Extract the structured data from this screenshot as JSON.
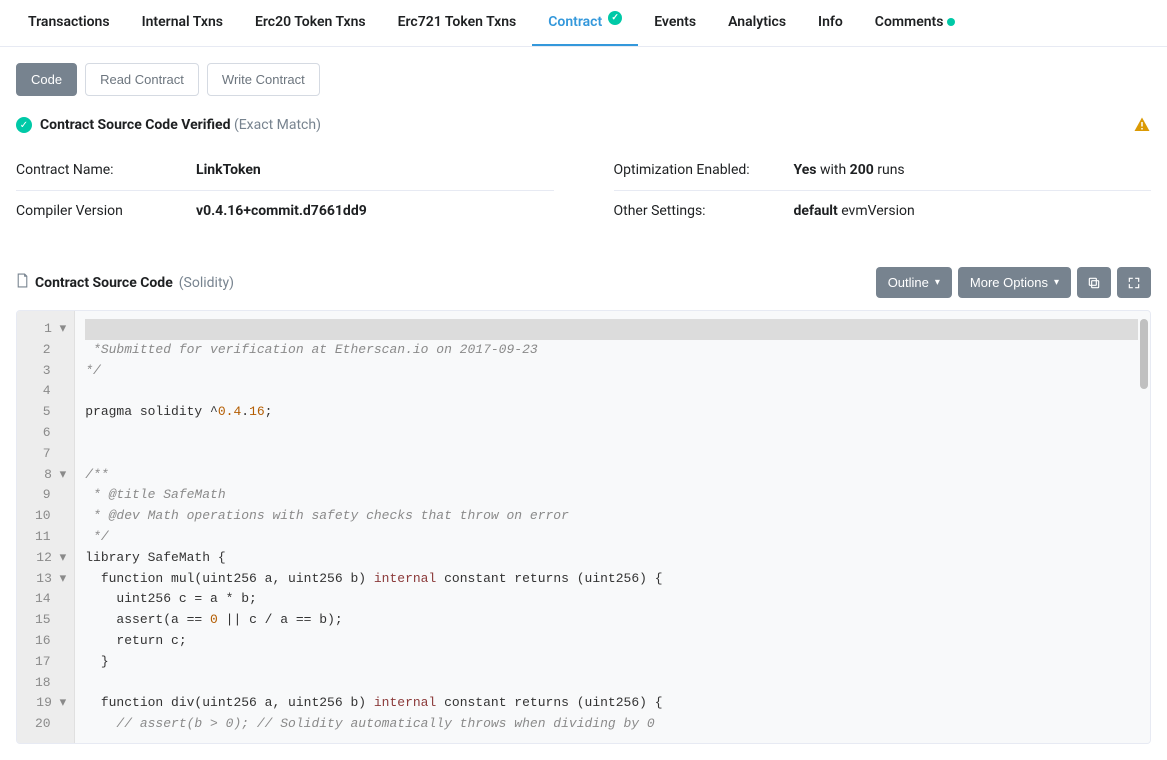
{
  "tabs": [
    {
      "label": "Transactions",
      "active": false
    },
    {
      "label": "Internal Txns",
      "active": false
    },
    {
      "label": "Erc20 Token Txns",
      "active": false
    },
    {
      "label": "Erc721 Token Txns",
      "active": false
    },
    {
      "label": "Contract",
      "active": true,
      "check": true
    },
    {
      "label": "Events",
      "active": false
    },
    {
      "label": "Analytics",
      "active": false
    },
    {
      "label": "Info",
      "active": false
    },
    {
      "label": "Comments",
      "active": false,
      "dot": true
    }
  ],
  "subtabs": {
    "code": "Code",
    "read": "Read Contract",
    "write": "Write Contract"
  },
  "verified": {
    "title": "Contract Source Code Verified",
    "match": "(Exact Match)"
  },
  "info": {
    "contract_name_label": "Contract Name:",
    "contract_name_value": "LinkToken",
    "compiler_label": "Compiler Version",
    "compiler_value": "v0.4.16+commit.d7661dd9",
    "opt_label": "Optimization Enabled:",
    "opt_yes": "Yes",
    "opt_with": " with ",
    "opt_runs": "200",
    "opt_runs_suffix": " runs",
    "other_label": "Other Settings:",
    "other_default": "default",
    "other_evm": " evmVersion"
  },
  "source": {
    "title": "Contract Source Code",
    "lang": "(Solidity)",
    "outline": "Outline",
    "more": "More Options"
  },
  "code": {
    "gutter": " 1 ▾\n 2  \n 3  \n 4  \n 5  \n 6  \n 7  \n 8 ▾\n 9  \n10  \n11  \n12 ▾\n13 ▾\n14  \n15  \n16  \n17  \n18  \n19 ▾\n20  ",
    "l1": "/**",
    "l2": " *Submitted for verification at Etherscan.io on 2017-09-23",
    "l3": "*/",
    "l4": "",
    "l5a": "pragma solidity ^",
    "l5b": "0.4",
    "l5c": ".",
    "l5d": "16",
    "l5e": ";",
    "l6": "",
    "l7": "",
    "l8": "/**",
    "l9": " * @title SafeMath",
    "l10": " * @dev Math operations with safety checks that throw on error",
    "l11": " */",
    "l12": "library SafeMath {",
    "l13a": "  function mul(uint256 a, uint256 b) ",
    "l13b": "internal",
    "l13c": " constant returns (uint256) {",
    "l14": "    uint256 c = a * b;",
    "l15a": "    assert(a == ",
    "l15b": "0",
    "l15c": " || c / a == b);",
    "l16": "    return c;",
    "l17": "  }",
    "l18": "",
    "l19a": "  function div(uint256 a, uint256 b) ",
    "l19b": "internal",
    "l19c": " constant returns (uint256) {",
    "l20": "    // assert(b > 0); // Solidity automatically throws when dividing by 0"
  }
}
